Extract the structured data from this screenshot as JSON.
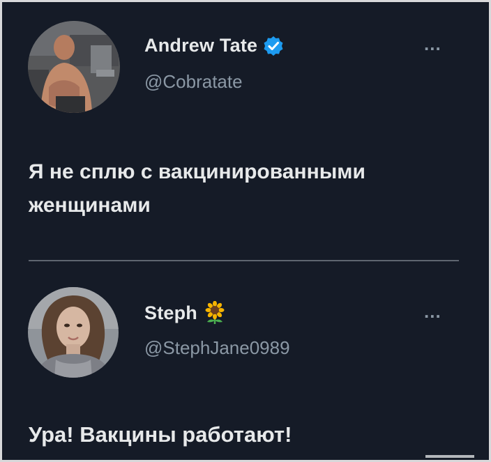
{
  "tweets": [
    {
      "author_name": "Andrew Tate",
      "author_handle": "@Cobratate",
      "verified": true,
      "text_line1": "Я не сплю с вакцинированными",
      "text_line2": "женщинами",
      "more_label": "..."
    },
    {
      "author_name": "Steph",
      "author_handle": "@StephJane0989",
      "name_emoji": "sunflower",
      "text_line1": "Ура! Вакцины работают!",
      "more_label": "..."
    }
  ],
  "colors": {
    "background": "#151b27",
    "text": "#e7e9ea",
    "secondary": "#8b98a5",
    "verified": "#1d9bf0",
    "divider": "#5f6670"
  }
}
